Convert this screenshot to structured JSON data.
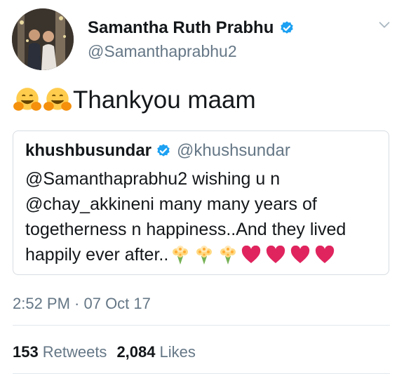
{
  "author": {
    "display_name": "Samantha Ruth Prabhu",
    "handle": "@Samanthaprabhu2"
  },
  "tweet": {
    "text": "Thankyou maam",
    "emojis": [
      "hugging-face",
      "hugging-face"
    ],
    "timestamp": "2:52 PM · 07 Oct 17"
  },
  "quoted_tweet": {
    "display_name": "khushbusundar",
    "handle": "@khushsundar",
    "lines": [
      "@Samanthaprabhu2 wishing u n",
      "@chay_akkineni many many years of",
      "togetherness n happiness..And they lived",
      "happily ever after.."
    ],
    "trailing_emojis": [
      "bouquet",
      "bouquet",
      "bouquet",
      "heart",
      "heart",
      "heart",
      "heart"
    ]
  },
  "stats": {
    "retweets_count": "153",
    "retweets_label": "Retweets",
    "likes_count": "2,084",
    "likes_label": "Likes"
  },
  "colors": {
    "text": "#14171a",
    "secondary": "#657786",
    "verified_blue": "#1da1f2",
    "heart_pink": "#e0245e",
    "border": "#d7dde2"
  }
}
